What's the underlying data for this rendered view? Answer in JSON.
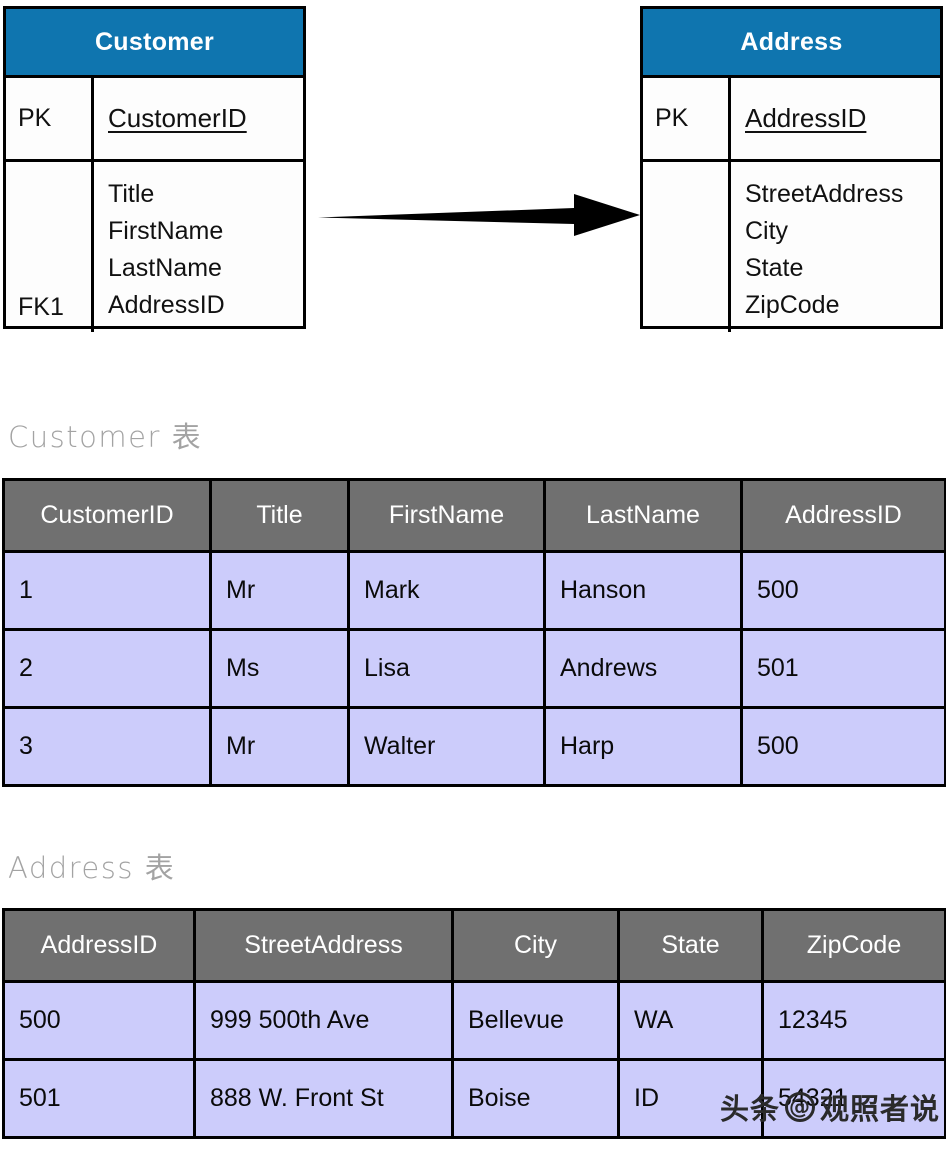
{
  "er_diagram": {
    "entities": [
      {
        "name": "Customer",
        "pk_label": "PK",
        "pk_field": "CustomerID",
        "fk_label": "FK1",
        "attributes": [
          "Title",
          "FirstName",
          "LastName",
          "AddressID"
        ]
      },
      {
        "name": "Address",
        "pk_label": "PK",
        "pk_field": "AddressID",
        "fk_label": "",
        "attributes": [
          "StreetAddress",
          "City",
          "State",
          "ZipCode"
        ]
      }
    ],
    "relationship": {
      "icon": "arrow-right-icon",
      "from": "Customer",
      "to": "Address"
    },
    "header_color": "#0F75AF"
  },
  "customer_section": {
    "caption": "Customer 表",
    "columns": [
      "CustomerID",
      "Title",
      "FirstName",
      "LastName",
      "AddressID"
    ],
    "rows": [
      [
        "1",
        "Mr",
        "Mark",
        "Hanson",
        "500"
      ],
      [
        "2",
        "Ms",
        "Lisa",
        "Andrews",
        "501"
      ],
      [
        "3",
        "Mr",
        "Walter",
        "Harp",
        "500"
      ]
    ]
  },
  "address_section": {
    "caption": "Address 表",
    "columns": [
      "AddressID",
      "StreetAddress",
      "City",
      "State",
      "ZipCode"
    ],
    "rows": [
      [
        "500",
        "999 500th Ave",
        "Bellevue",
        "WA",
        "12345"
      ],
      [
        "501",
        "888 W. Front St",
        "Boise",
        "ID",
        "54321"
      ]
    ]
  },
  "watermark": {
    "platform": "头条",
    "at": "@",
    "account": "观照者说"
  },
  "colors": {
    "entity_header": "#0F75AF",
    "table_header": "#707070",
    "table_row": "#CCCCFB",
    "border": "#000000",
    "caption": "#A3A3A3"
  }
}
